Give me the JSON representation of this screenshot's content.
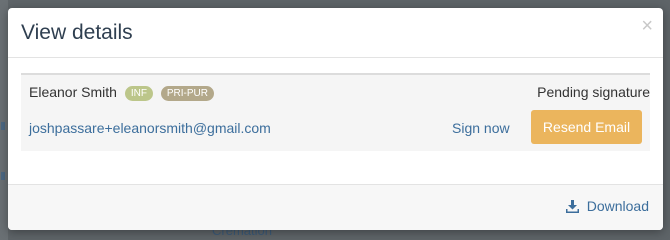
{
  "background": {
    "partial_text": "Cremation"
  },
  "modal": {
    "title": "View details",
    "close_symbol": "×"
  },
  "signer": {
    "name": "Eleanor Smith",
    "badges": [
      "INF",
      "PRI-PUR"
    ],
    "status": "Pending signature",
    "email": "joshpassare+eleanorsmith@gmail.com",
    "sign_now_label": "Sign now",
    "resend_label": "Resend Email"
  },
  "footer": {
    "download_label": "Download",
    "download_icon": "download-icon"
  },
  "colors": {
    "resend_button": "#ebb55d",
    "link": "#3c6e9c",
    "badge_inf": "#bcc68a",
    "badge_pri": "#b3a88a"
  }
}
